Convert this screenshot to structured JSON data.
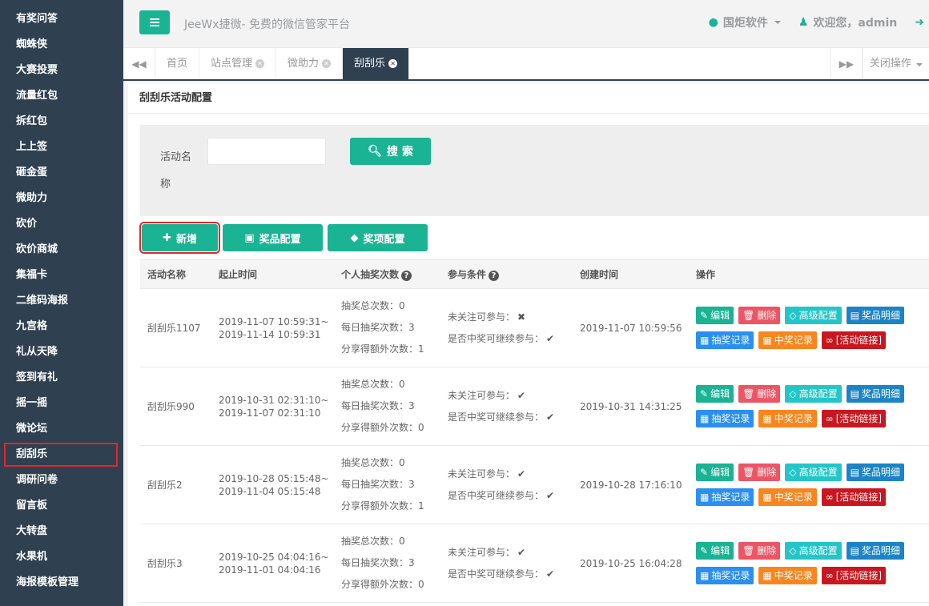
{
  "sidebar": {
    "items": [
      {
        "label": "有奖问答"
      },
      {
        "label": "蜘蛛侠"
      },
      {
        "label": "大赛投票"
      },
      {
        "label": "流量红包"
      },
      {
        "label": "拆红包"
      },
      {
        "label": "上上签"
      },
      {
        "label": "砸金蛋"
      },
      {
        "label": "微助力"
      },
      {
        "label": "砍价"
      },
      {
        "label": "砍价商城"
      },
      {
        "label": "集福卡"
      },
      {
        "label": "二维码海报"
      },
      {
        "label": "九宫格"
      },
      {
        "label": "礼从天降"
      },
      {
        "label": "签到有礼"
      },
      {
        "label": "摇一摇"
      },
      {
        "label": "微论坛"
      },
      {
        "label": "刮刮乐",
        "active": true
      },
      {
        "label": "调研问卷"
      },
      {
        "label": "留言板"
      },
      {
        "label": "大转盘"
      },
      {
        "label": "水果机"
      },
      {
        "label": "海报模板管理"
      }
    ]
  },
  "header": {
    "site_title": "JeeWx捷微- 免费的微信管家平台",
    "company": "国炬软件",
    "welcome": "欢迎您，admin"
  },
  "tabs": {
    "items": [
      {
        "label": "首页",
        "closable": false
      },
      {
        "label": "站点管理",
        "closable": true
      },
      {
        "label": "微助力",
        "closable": true
      },
      {
        "label": "刮刮乐",
        "closable": true,
        "active": true
      }
    ],
    "close_ops": "关闭操作"
  },
  "panel": {
    "title": "刮刮乐活动配置"
  },
  "search": {
    "label": "活动名称",
    "value": "",
    "button": "搜 索"
  },
  "actions": {
    "add": "新增",
    "prize_config": "奖品配置",
    "item_config": "奖项配置"
  },
  "table": {
    "headers": {
      "name": "活动名称",
      "period": "起止时间",
      "draws": "个人抽奖次数",
      "conditions": "参与条件",
      "created": "创建时间",
      "ops": "操作"
    },
    "count_labels": {
      "total": "抽奖总次数：",
      "daily": "每日抽奖次数：",
      "share": "分享得额外次数："
    },
    "cond_labels": {
      "follow": "未关注可参与：",
      "continue": "是否中奖可继续参与："
    },
    "op_labels": {
      "edit": "编辑",
      "del": "删除",
      "adv": "高级配置",
      "detail": "奖品明细",
      "draw": "抽奖记录",
      "win": "中奖记录",
      "link": "[活动链接]"
    },
    "rows": [
      {
        "name": "刮刮乐1107",
        "start": "2019-11-07 10:59:31~",
        "end": "2019-11-14 10:59:31",
        "total": "0",
        "daily": "3",
        "share": "1",
        "follow": "✖",
        "continue": "✔",
        "created": "2019-11-07 10:59:56"
      },
      {
        "name": "刮刮乐990",
        "start": "2019-10-31 02:31:10~",
        "end": "2019-11-07 02:31:10",
        "total": "0",
        "daily": "3",
        "share": "0",
        "follow": "✔",
        "continue": "✔",
        "created": "2019-10-31 14:31:25"
      },
      {
        "name": "刮刮乐2",
        "start": "2019-10-28 05:15:48~",
        "end": "2019-11-04 05:15:48",
        "total": "0",
        "daily": "3",
        "share": "1",
        "follow": "✔",
        "continue": "✔",
        "created": "2019-10-28 17:16:10"
      },
      {
        "name": "刮刮乐3",
        "start": "2019-10-25 04:04:16~",
        "end": "2019-11-01 04:04:16",
        "total": "0",
        "daily": "3",
        "share": "0",
        "follow": "✔",
        "continue": "✔",
        "created": "2019-10-25 16:04:28"
      }
    ]
  }
}
